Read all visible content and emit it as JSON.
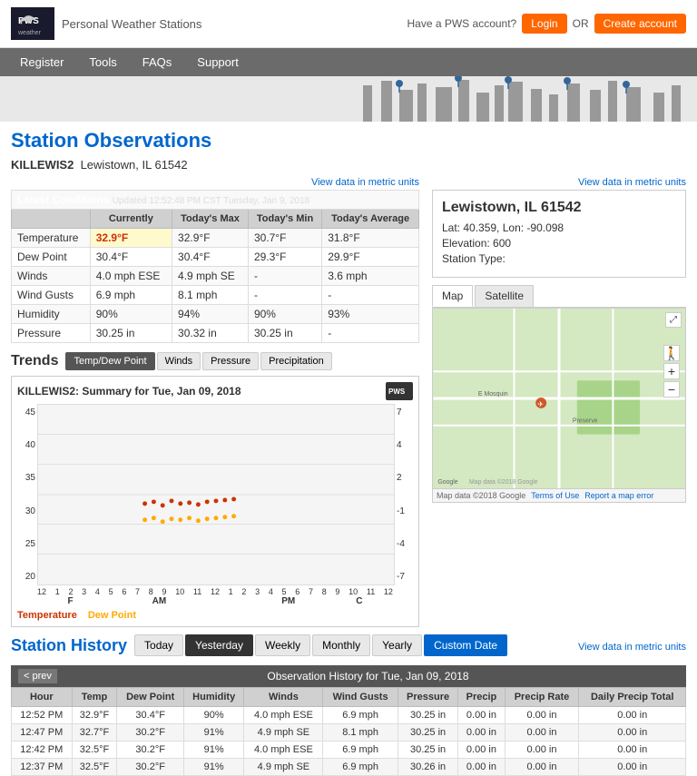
{
  "header": {
    "logo_text": "PWS",
    "logo_sub": "weather",
    "pws_label": "Personal Weather Stations",
    "account_text": "Have a PWS account?",
    "login_label": "Login",
    "or_text": "OR",
    "create_label": "Create account"
  },
  "nav": {
    "items": [
      "Register",
      "Tools",
      "FAQs",
      "Support"
    ]
  },
  "page": {
    "title": "Station Observations",
    "station_id": "KILLEWIS2",
    "station_location": "Lewistown, IL 61542",
    "metric_link": "View data in metric units"
  },
  "conditions": {
    "header_label": "Latest Conditions",
    "updated_text": "Updated 12:52:48 PM CST Tuesday, Jan 9, 2018",
    "col_currently": "Currently",
    "col_max": "Today's Max",
    "col_min": "Today's Min",
    "col_avg": "Today's Average",
    "rows": [
      {
        "label": "Temperature",
        "currently": "32.9°F",
        "max": "32.9°F",
        "min": "30.7°F",
        "avg": "31.8°F"
      },
      {
        "label": "Dew Point",
        "currently": "30.4°F",
        "max": "30.4°F",
        "min": "29.3°F",
        "avg": "29.9°F"
      },
      {
        "label": "Winds",
        "currently": "4.0 mph ESE",
        "max": "4.9 mph SE",
        "min": "-",
        "avg": "3.6 mph"
      },
      {
        "label": "Wind Gusts",
        "currently": "6.9 mph",
        "max": "8.1 mph",
        "min": "-",
        "avg": "-"
      },
      {
        "label": "Humidity",
        "currently": "90%",
        "max": "94%",
        "min": "90%",
        "avg": "93%"
      },
      {
        "label": "Pressure",
        "currently": "30.25 in",
        "max": "30.32 in",
        "min": "30.25 in",
        "avg": "-"
      }
    ]
  },
  "trends": {
    "title": "Trends",
    "tabs": [
      "Temp/Dew Point",
      "Winds",
      "Pressure",
      "Precipitation"
    ],
    "active_tab": 0,
    "chart_title": "KILLEWIS2: Summary for Tue, Jan 09, 2018",
    "y_left_labels": [
      "45",
      "40",
      "35",
      "30",
      "25",
      "20"
    ],
    "y_right_labels": [
      "7",
      "4",
      "2",
      "-1",
      "-4",
      "-7"
    ],
    "x_labels_am": [
      "12",
      "1",
      "2",
      "3",
      "4",
      "5",
      "6",
      "7",
      "8",
      "9",
      "10",
      "11",
      "12"
    ],
    "x_labels_pm": [
      "1",
      "2",
      "3",
      "4",
      "5",
      "6",
      "7",
      "8",
      "9",
      "10",
      "11",
      "12"
    ],
    "x_label_am": "AM",
    "x_label_pm": "PM",
    "y_label_f": "F",
    "y_label_c": "C",
    "legend_temp": "Temperature",
    "legend_dew": "Dew Point"
  },
  "info": {
    "title": "Lewistown, IL 61542",
    "lat": "Lat: 40.359, Lon: -90.098",
    "elevation": "Elevation: 600",
    "station_type": "Station Type:"
  },
  "map": {
    "tab_map": "Map",
    "tab_satellite": "Satellite"
  },
  "history": {
    "title": "Station History",
    "tabs": [
      "Today",
      "Yesterday",
      "Weekly",
      "Monthly",
      "Yearly",
      "Custom Date"
    ],
    "active_tab": 1,
    "metric_link": "View data in metric units",
    "obs_title": "Observation History for Tue, Jan 09, 2018",
    "prev_label": "< prev",
    "columns": [
      "Hour",
      "Temp",
      "Dew Point",
      "Humidity",
      "Winds",
      "Wind Gusts",
      "Pressure",
      "Precip",
      "Precip Rate",
      "Daily Precip Total"
    ],
    "rows": [
      {
        "hour": "12:52 PM",
        "temp": "32.9°F",
        "dew": "30.4°F",
        "humidity": "90%",
        "winds": "4.0 mph ESE",
        "gusts": "6.9 mph",
        "pressure": "30.25 in",
        "precip": "0.00 in",
        "rate": "0.00 in",
        "daily": "0.00 in"
      },
      {
        "hour": "12:47 PM",
        "temp": "32.7°F",
        "dew": "30.2°F",
        "humidity": "91%",
        "winds": "4.9 mph SE",
        "gusts": "8.1 mph",
        "pressure": "30.25 in",
        "precip": "0.00 in",
        "rate": "0.00 in",
        "daily": "0.00 in"
      },
      {
        "hour": "12:42 PM",
        "temp": "32.5°F",
        "dew": "30.2°F",
        "humidity": "91%",
        "winds": "4.0 mph ESE",
        "gusts": "6.9 mph",
        "pressure": "30.25 in",
        "precip": "0.00 in",
        "rate": "0.00 in",
        "daily": "0.00 in"
      },
      {
        "hour": "12:37 PM",
        "temp": "32.5°F",
        "dew": "30.2°F",
        "humidity": "91%",
        "winds": "4.9 mph SE",
        "gusts": "6.9 mph",
        "pressure": "30.26 in",
        "precip": "0.00 in",
        "rate": "0.00 in",
        "daily": "0.00 in"
      }
    ]
  }
}
